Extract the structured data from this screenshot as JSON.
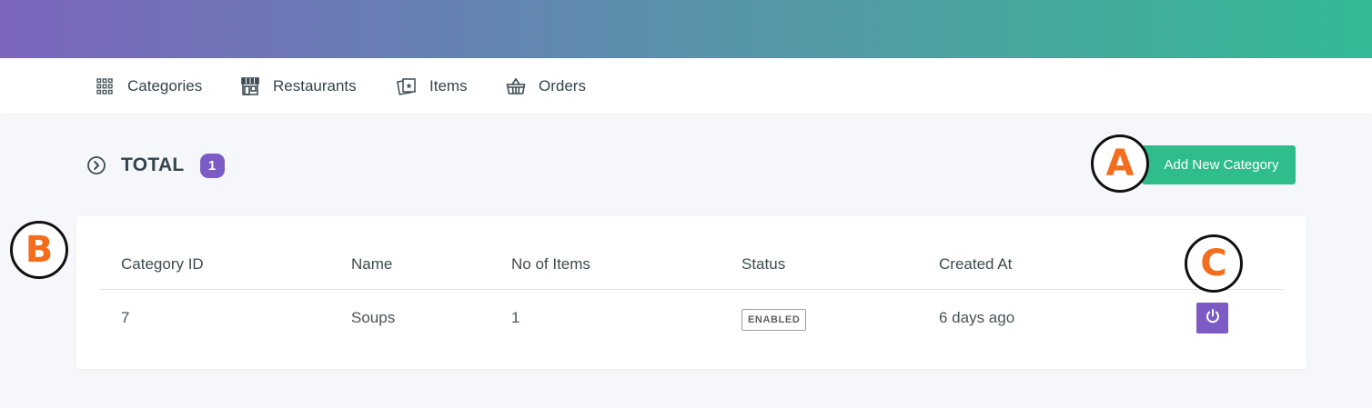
{
  "nav": {
    "items": [
      {
        "label": "Categories",
        "icon": "grid-icon"
      },
      {
        "label": "Restaurants",
        "icon": "storefront-icon"
      },
      {
        "label": "Items",
        "icon": "cards-star-icon"
      },
      {
        "label": "Orders",
        "icon": "basket-icon"
      }
    ]
  },
  "summary": {
    "title": "TOTAL",
    "count": "1",
    "add_button_label": "Add New Category"
  },
  "table": {
    "headers": [
      "Category ID",
      "Name",
      "No of Items",
      "Status",
      "Created At"
    ],
    "rows": [
      {
        "id": "7",
        "name": "Soups",
        "items": "1",
        "status": "ENABLED",
        "created": "6 days ago"
      }
    ]
  },
  "markers": {
    "a": "A",
    "b": "B",
    "c": "C"
  },
  "colors": {
    "accent_purple": "#7c5bc4",
    "accent_green": "#2fbd8c",
    "marker_orange": "#f36d1c"
  }
}
